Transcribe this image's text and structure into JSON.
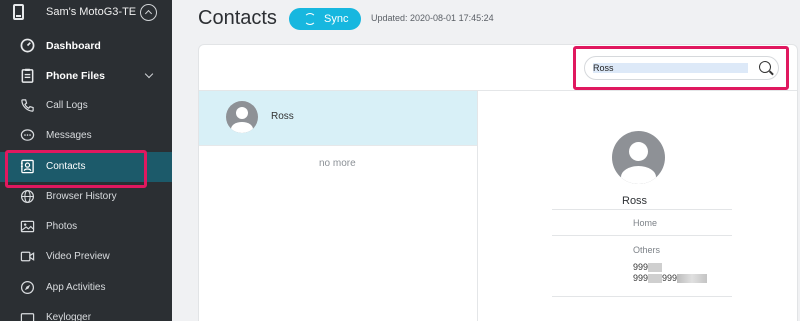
{
  "device": {
    "name": "Sam's MotoG3-TE"
  },
  "sidebar": {
    "items": [
      {
        "label": "Dashboard"
      },
      {
        "label": "Phone Files"
      },
      {
        "label": "Call Logs"
      },
      {
        "label": "Messages"
      },
      {
        "label": "Contacts"
      },
      {
        "label": "Browser History"
      },
      {
        "label": "Photos"
      },
      {
        "label": "Video Preview"
      },
      {
        "label": "App Activities"
      },
      {
        "label": "Keylogger"
      }
    ]
  },
  "header": {
    "title": "Contacts",
    "sync_label": "Sync",
    "updated": "Updated: 2020-08-01 17:45:24"
  },
  "search": {
    "value": "Ross"
  },
  "list": {
    "contacts": [
      {
        "name": "Ross"
      }
    ],
    "end_text": "no more"
  },
  "detail": {
    "name": "Ross",
    "home_label": "Home",
    "others_label": "Others",
    "phone_line1_visible": "999",
    "phone_line2_prefix": "999",
    "phone_line2_mid": "999"
  },
  "colors": {
    "sidebar_bg": "#2b2f33",
    "active_item_bg": "#1c5a6a",
    "sync_button": "#17b7df",
    "highlight": "#e0185f",
    "selected_row_bg": "#d8f0f7"
  }
}
